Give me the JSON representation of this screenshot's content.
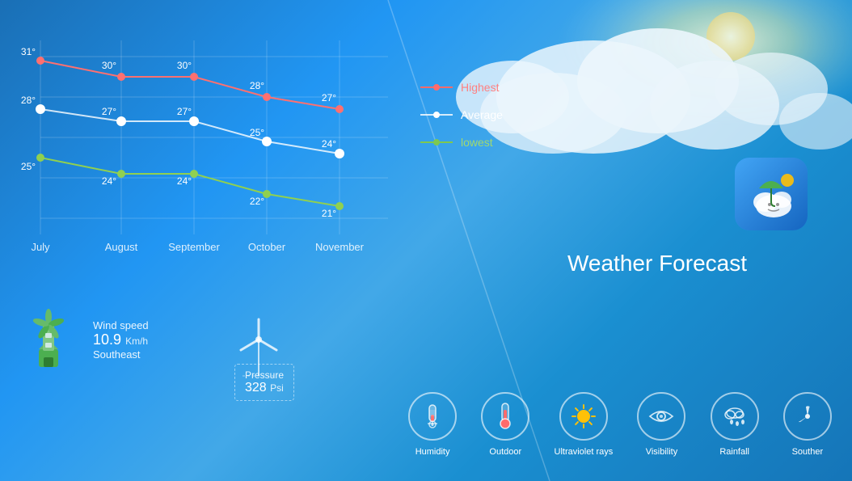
{
  "app": {
    "title": "Weather Forecast"
  },
  "chart": {
    "months": [
      "July",
      "August",
      "September",
      "October",
      "November"
    ],
    "highest": {
      "label": "Highest",
      "color": "#ff7070",
      "values": [
        31,
        30,
        30,
        28,
        27
      ],
      "temps": [
        "31°",
        "30°",
        "30°",
        "28°",
        "27°"
      ]
    },
    "average": {
      "label": "Average",
      "color": "rgba(255,255,255,0.85)",
      "values": [
        28,
        27,
        27,
        25,
        24
      ],
      "temps": [
        "28°",
        "27°",
        "27°",
        "25°",
        "24°"
      ]
    },
    "lowest": {
      "label": "lowest",
      "color": "#90d050",
      "values": [
        25,
        24,
        24,
        22,
        21
      ],
      "temps": [
        "25°",
        "24°",
        "24°",
        "22°",
        "21°"
      ]
    }
  },
  "wind": {
    "label": "Wind speed",
    "speed": "10.9",
    "unit": "Km/h",
    "direction": "Southeast"
  },
  "pressure": {
    "label": "Pressure",
    "value": "328",
    "unit": "Psi"
  },
  "icons": [
    {
      "name": "humidity",
      "label": "Humidity",
      "symbol": "💧"
    },
    {
      "name": "outdoor",
      "label": "Outdoor",
      "symbol": "🌡"
    },
    {
      "name": "uv",
      "label": "Ultraviolet rays",
      "symbol": "☀"
    },
    {
      "name": "visibility",
      "label": "Visibility",
      "symbol": "👁"
    },
    {
      "name": "rainfall",
      "label": "Rainfall",
      "symbol": "🌧"
    },
    {
      "name": "souther",
      "label": "Souther",
      "symbol": "⊕"
    }
  ],
  "colors": {
    "bg": "#1a8fd1",
    "accent": "#ffffff",
    "highest": "#ff7070",
    "average": "#ffffff",
    "lowest": "#90d050"
  }
}
